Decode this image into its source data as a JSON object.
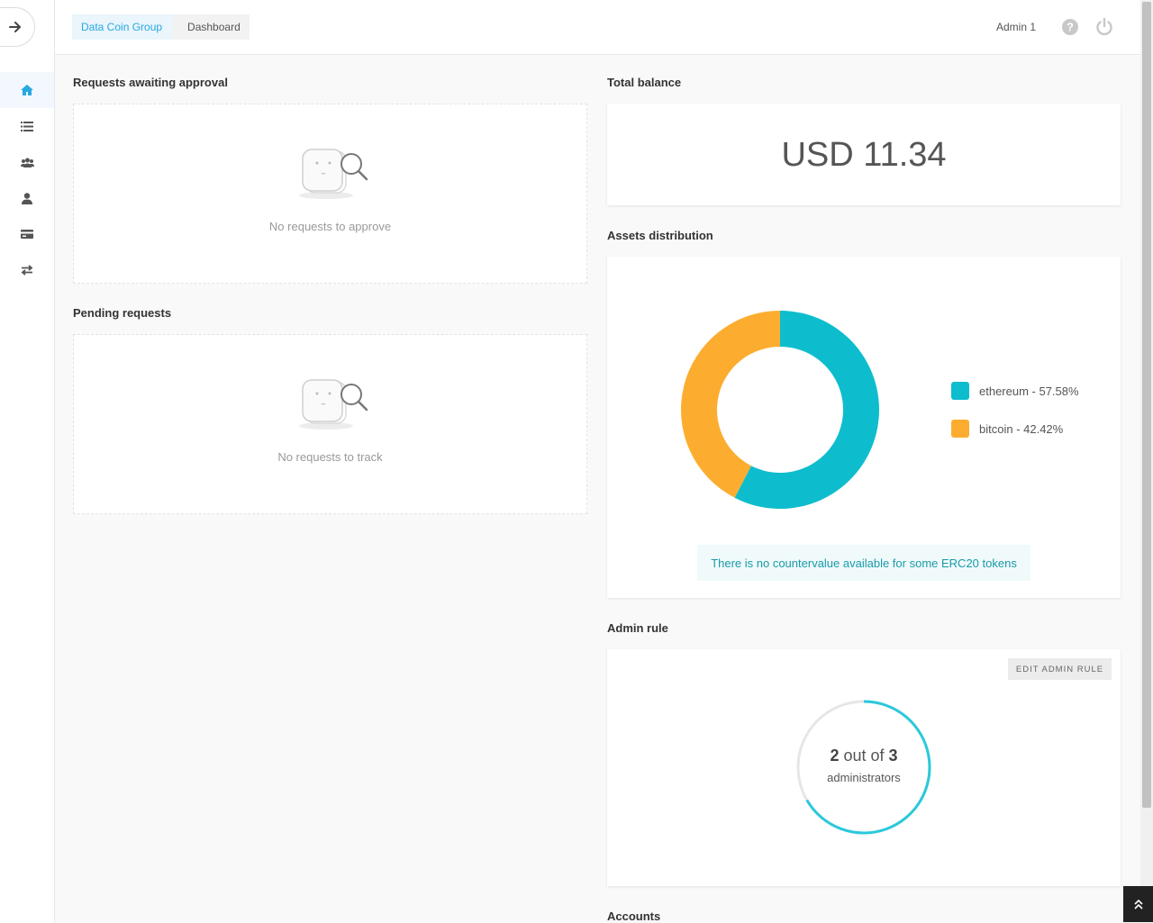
{
  "sidebar": {
    "items": [
      {
        "name": "home",
        "icon": "home-icon",
        "active": true
      },
      {
        "name": "requests",
        "icon": "list-icon",
        "active": false
      },
      {
        "name": "groups",
        "icon": "users-icon",
        "active": false
      },
      {
        "name": "members",
        "icon": "user-icon",
        "active": false
      },
      {
        "name": "accounts",
        "icon": "wallet-icon",
        "active": false
      },
      {
        "name": "transactions",
        "icon": "exchange-icon",
        "active": false
      }
    ]
  },
  "header": {
    "breadcrumb": [
      "Data Coin Group",
      "Dashboard"
    ],
    "user": "Admin 1"
  },
  "approval": {
    "title": "Requests awaiting approval",
    "empty_text": "No requests to approve"
  },
  "pending": {
    "title": "Pending requests",
    "empty_text": "No requests to track"
  },
  "balance": {
    "title": "Total balance",
    "value": "USD 11.34"
  },
  "assets": {
    "title": "Assets distribution",
    "legend": [
      "ethereum - 57.58%",
      "bitcoin - 42.42%"
    ],
    "notice": "There is no countervalue available for some ERC20 tokens"
  },
  "chart_data": {
    "type": "pie",
    "categories": [
      "ethereum",
      "bitcoin"
    ],
    "values": [
      57.58,
      42.42
    ],
    "colors": [
      "#0ebdcd",
      "#fcad2f"
    ],
    "title": "",
    "legend_position": "right"
  },
  "admin_rule": {
    "title": "Admin rule",
    "edit_label": "EDIT ADMIN RULE",
    "required": "2",
    "total": "3",
    "out_of": "out of",
    "unit": "administrators",
    "progress": 0.6667
  },
  "accounts": {
    "title": "Accounts"
  },
  "colors": {
    "accent": "#27a9e1",
    "teal": "#0ebdcd",
    "orange": "#fcad2f",
    "ring": "#2ac8dc"
  }
}
